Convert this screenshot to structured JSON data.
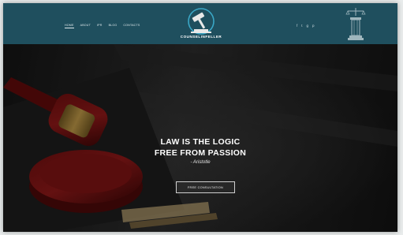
{
  "nav": {
    "items": [
      {
        "label": "HOME"
      },
      {
        "label": "ABOUT"
      },
      {
        "label": "IPR"
      },
      {
        "label": "BLOG"
      },
      {
        "label": "CONTACTS"
      }
    ]
  },
  "logo": {
    "text": "COUNSELINFELLER"
  },
  "social": {
    "icons": [
      "facebook-icon",
      "twitter-icon",
      "google-plus-icon",
      "pinterest-icon"
    ]
  },
  "hero": {
    "headline_line1": "LAW IS THE LOGIC",
    "headline_line2": "FREE FROM PASSION",
    "author": "- Aristotle",
    "cta_label": "FREE CONSULTATION"
  },
  "colors": {
    "header": "#1f4f5e",
    "accent": "#3aa7c6"
  }
}
